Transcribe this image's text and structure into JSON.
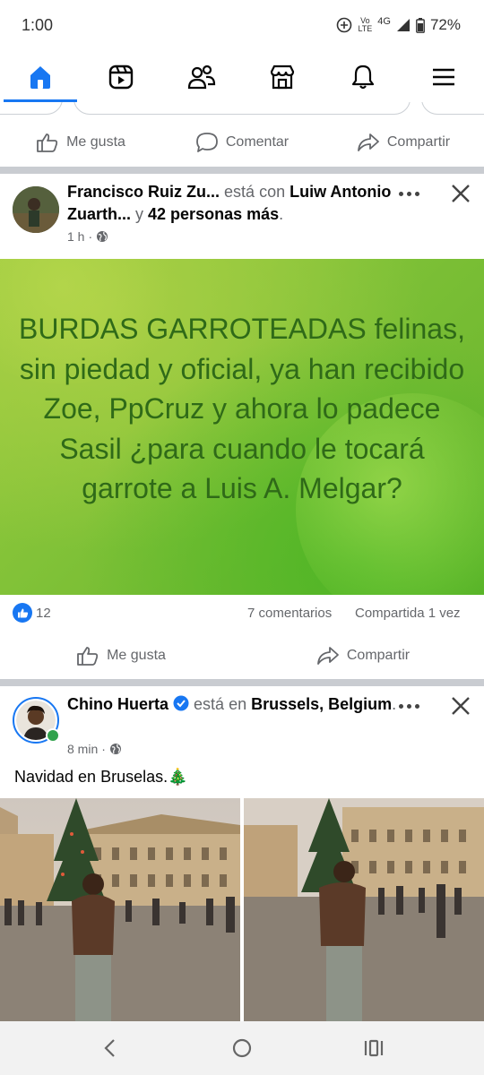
{
  "status": {
    "time": "1:00",
    "network": "4G",
    "battery": "72%",
    "volte_top": "Vo",
    "volte_bottom": "LTE"
  },
  "nav": {
    "items": [
      {
        "name": "home",
        "active": true
      },
      {
        "name": "reels"
      },
      {
        "name": "friends"
      },
      {
        "name": "marketplace"
      },
      {
        "name": "notifications"
      },
      {
        "name": "menu"
      }
    ]
  },
  "prev_post_actions": {
    "like": "Me gusta",
    "comment": "Comentar",
    "share": "Compartir"
  },
  "post1": {
    "author": "Francisco Ruiz Zu...",
    "with_text": "está con",
    "tagged": "Luiw Antonio Zuarth...",
    "and_text": "y",
    "others": "42 personas más",
    "time": "1 h",
    "card_text": "BURDAS GARROTEADAS felinas, sin piedad y oficial, ya han recibido Zoe, PpCruz y ahora lo padece Sasil ¿para cuando le tocará garrote a Luis A. Melgar?",
    "reaction_count": "12",
    "comments": "7 comentarios",
    "shares": "Compartida 1 vez",
    "like_label": "Me gusta",
    "share_label": "Compartir"
  },
  "post2": {
    "author": "Chino Huerta",
    "at_text": "está en",
    "location": "Brussels, Belgium",
    "time": "8 min",
    "body": "Navidad en Bruselas.🎄"
  },
  "colors": {
    "accent": "#1877f2",
    "card_text": "#2f6a18"
  }
}
